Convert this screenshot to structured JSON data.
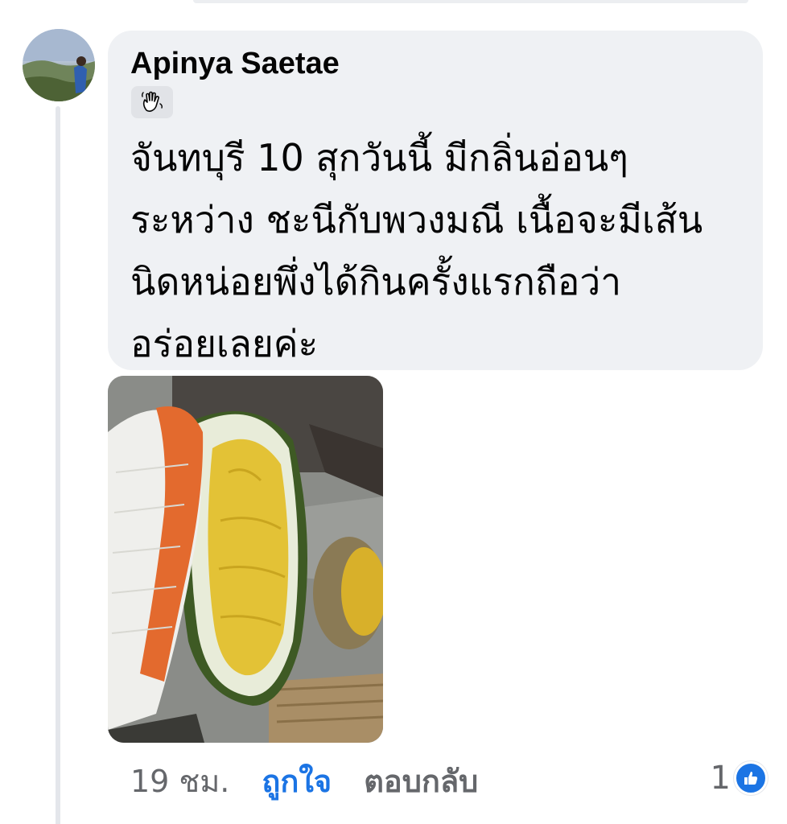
{
  "comment": {
    "author": "Apinya Saetae",
    "badge_icon": "waving-hand-icon",
    "text": "จันทบุรี 10 สุกวันนี้  มีกลิ่นอ่อนๆ\nระหว่าง  ชะนีกับพวงมณี เนื้อจะมีเส้น\nนิดหน่อยพึ่งได้กินครั้งแรกถือว่า\nอร่อยเลยค่ะ",
    "photo_icon": "durian-photo"
  },
  "actions": {
    "time": "19 ชม.",
    "like_label": "ถูกใจ",
    "reply_label": "ตอบกลับ"
  },
  "reactions": {
    "count": "1",
    "icon": "thumbs-up-icon",
    "color": "#1b74e4"
  },
  "colors": {
    "bubble": "#eff1f4",
    "accent": "#1b74e4",
    "secondary_text": "#65676b"
  }
}
